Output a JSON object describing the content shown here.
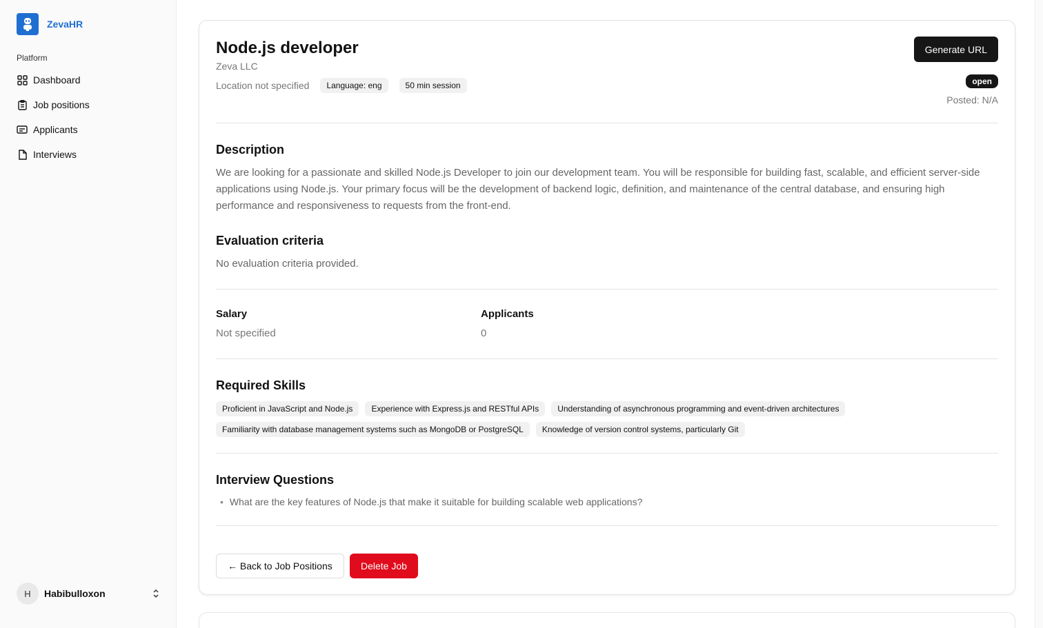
{
  "sidebar": {
    "brand": "ZevaHR",
    "group_label": "Platform",
    "items": [
      {
        "label": "Dashboard",
        "icon": "dashboard-grid-icon"
      },
      {
        "label": "Job positions",
        "icon": "clipboard-icon"
      },
      {
        "label": "Applicants",
        "icon": "tickets-icon"
      },
      {
        "label": "Interviews",
        "icon": "file-icon"
      }
    ],
    "user": {
      "initial": "H",
      "name": "Habibulloxon"
    }
  },
  "job": {
    "title": "Node.js developer",
    "company": "Zeva LLC",
    "location": "Location not specified",
    "language": "Language: eng",
    "session": "50 min session",
    "generate_label": "Generate URL",
    "status": "open",
    "posted": "Posted: N/A",
    "description_heading": "Description",
    "description": "We are looking for a passionate and skilled Node.js Developer to join our development team. You will be responsible for building fast, scalable, and efficient server-side applications using Node.js. Your primary focus will be the development of backend logic, definition, and maintenance of the central database, and ensuring high performance and responsiveness to requests from the front-end.",
    "criteria_heading": "Evaluation criteria",
    "criteria": "No evaluation criteria provided.",
    "salary_label": "Salary",
    "salary_value": "Not specified",
    "applicants_label": "Applicants",
    "applicants_value": "0",
    "skills_heading": "Required Skills",
    "skills": [
      "Proficient in JavaScript and Node.js",
      "Experience with Express.js and RESTful APIs",
      "Understanding of asynchronous programming and event-driven architectures",
      "Familiarity with database management systems such as MongoDB or PostgreSQL",
      "Knowledge of version control systems, particularly Git"
    ],
    "questions_heading": "Interview Questions",
    "questions": [
      "What are the key features of Node.js that make it suitable for building scalable web applications?"
    ],
    "back_label": "← Back to Job Positions",
    "delete_label": "Delete Job"
  },
  "colors": {
    "brand": "#1f6fd1",
    "danger": "#e00b1c",
    "dark": "#161616"
  }
}
